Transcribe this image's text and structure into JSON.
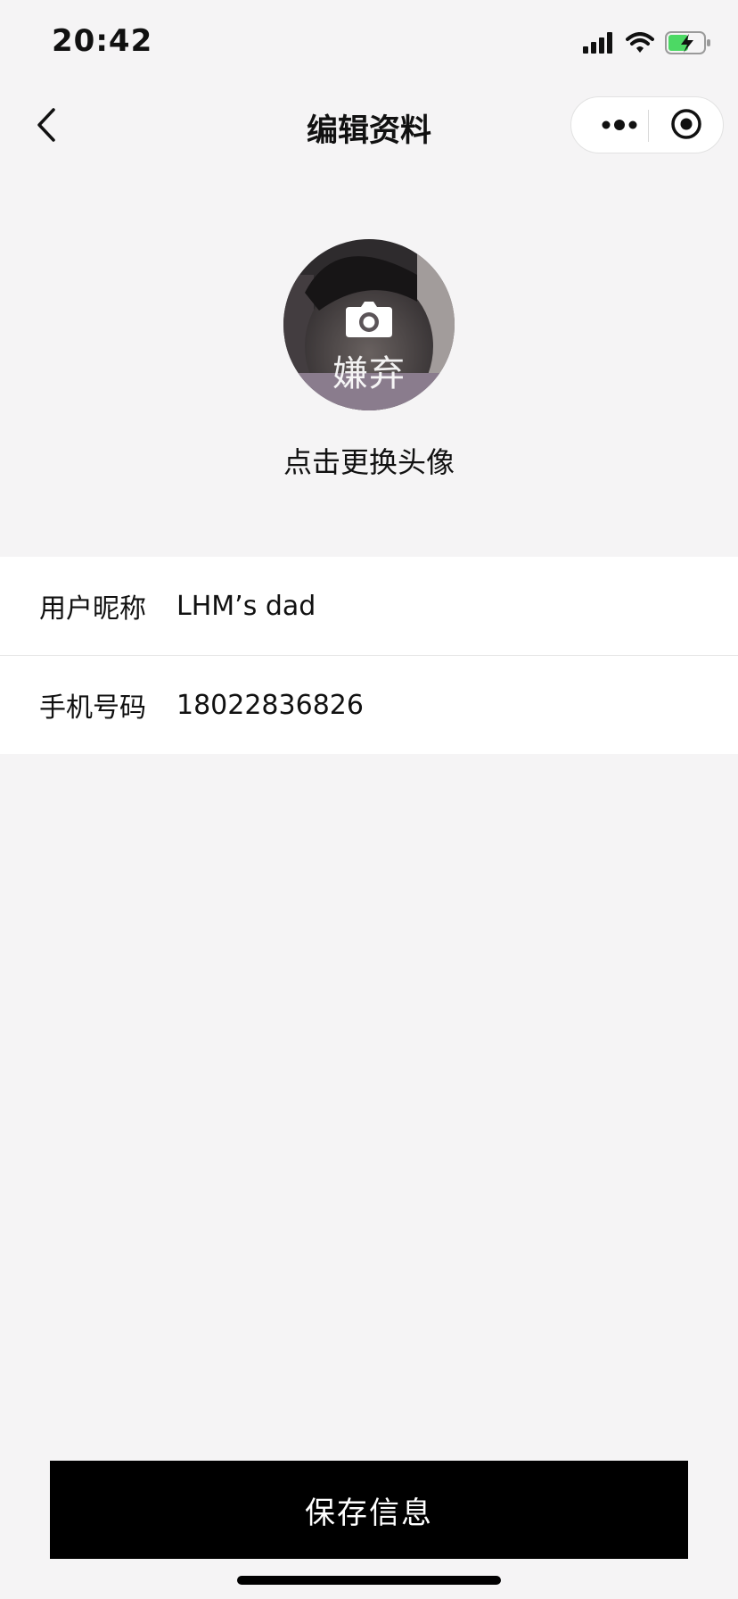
{
  "status_bar": {
    "time": "20:42"
  },
  "nav": {
    "title": "编辑资料"
  },
  "avatar": {
    "overlay_text": "嫌弃",
    "change_label": "点击更换头像"
  },
  "form": {
    "rows": [
      {
        "label": "用户昵称",
        "value": "LHM’s dad"
      },
      {
        "label": "手机号码",
        "value": "18022836826"
      }
    ]
  },
  "footer": {
    "save_label": "保存信息"
  },
  "colors": {
    "page_bg": "#f5f4f5",
    "button_bg": "#000000",
    "battery_green": "#4cd964"
  }
}
